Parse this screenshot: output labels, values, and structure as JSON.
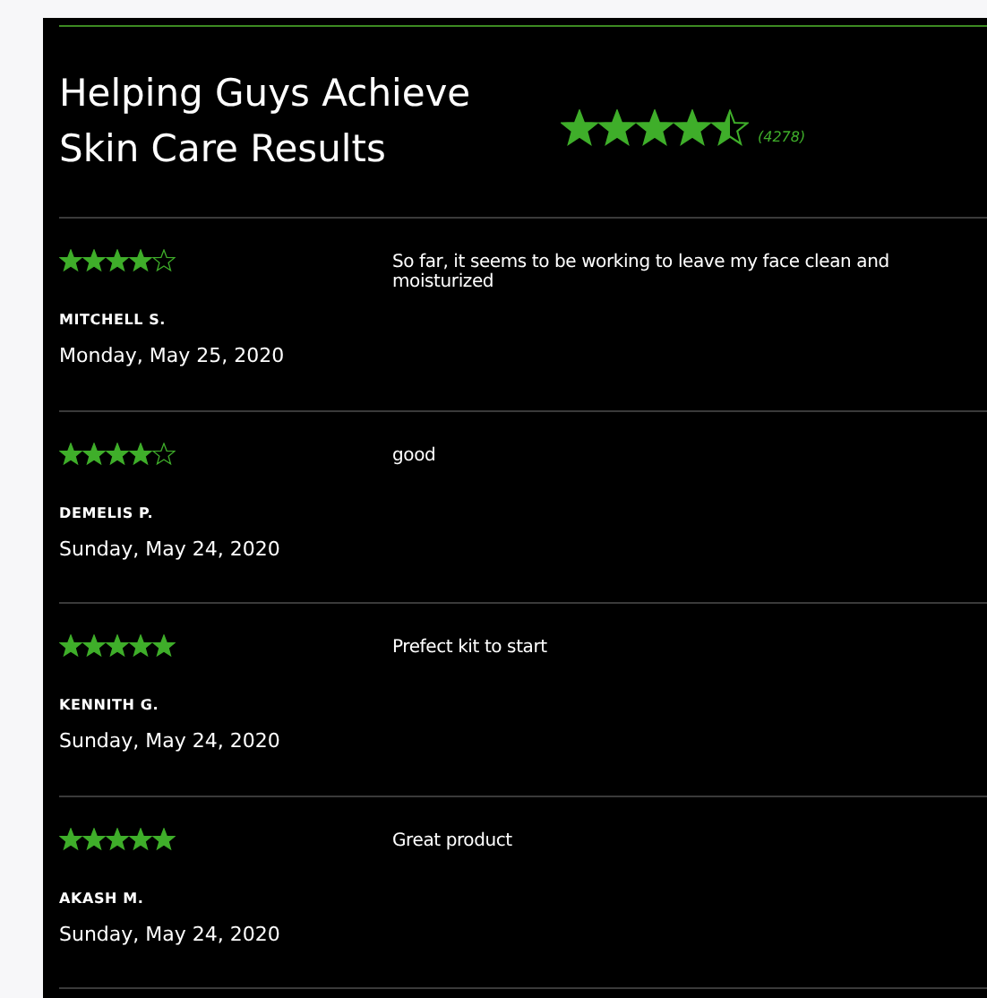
{
  "header": {
    "title": "Helping Guys Achieve Skin Care Results",
    "stars": 4.5,
    "count": "(4278)"
  },
  "reviews": [
    {
      "stars": 4,
      "text": "So far, it seems to be working to leave my face clean and moisturized",
      "author": "MITCHELL S.",
      "date": "Monday, May 25, 2020"
    },
    {
      "stars": 4,
      "text": "good",
      "author": "DEMELIS P.",
      "date": "Sunday, May 24, 2020"
    },
    {
      "stars": 5,
      "text": "Prefect kit to start",
      "author": "KENNITH G.",
      "date": "Sunday, May 24, 2020"
    },
    {
      "stars": 5,
      "text": "Great product",
      "author": "AKASH M.",
      "date": "Sunday, May 24, 2020"
    }
  ]
}
